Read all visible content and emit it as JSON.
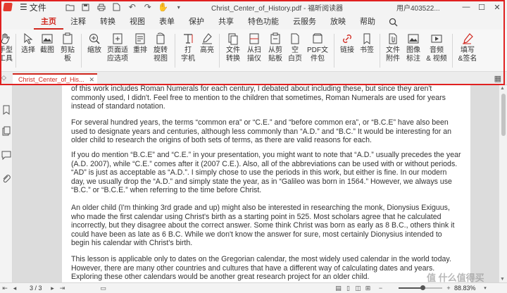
{
  "titlebar": {
    "menu_label": "文件",
    "doc_title": "Christ_Center_of_History.pdf - 福昕阅读器",
    "user": "用户403522..."
  },
  "tabs": [
    "主页",
    "注释",
    "转换",
    "视图",
    "表单",
    "保护",
    "共享",
    "特色功能",
    "云服务",
    "放映",
    "帮助"
  ],
  "active_tab": "主页",
  "ribbon": {
    "hand": "手型\n工具",
    "select": "选择",
    "snapshot": "截图",
    "clipboard": "剪贴\n板",
    "zoom": "缩放",
    "fit_page": "页面适\n应选项",
    "reflow": "重排",
    "rotate": "旋转\n视图",
    "typewriter": "打\n字机",
    "highlight": "高亮",
    "convert": "文件\n转换",
    "from_scanner": "从扫\n描仪",
    "from_clipboard": "从剪\n贴板",
    "blank": "空\n白页",
    "pdf_pack": "PDF文\n件包",
    "link": "链接",
    "bookmark": "书签",
    "attach": "文件\n附件",
    "image_note": "图像\n标注",
    "audio_video": "音频\n& 视频",
    "fill_sign": "填写\n&签名"
  },
  "doc_tab": {
    "label": "Christ_Center_of_His..."
  },
  "document": {
    "paragraphs": [
      "of this work includes Roman Numerals for each century, I debated about including these, but since they aren't commonly used, I didn't. Feel free to mention to the children that sometimes, Roman Numerals are used for years instead of standard notation.",
      "For several hundred years, the terms “common era” or “C.E.” and “before common era”, or “B.C.E” have also been used to designate years and centuries, although less commonly than “A.D.” and “B.C.” It would be interesting for an older child to research the origins of both sets of terms, as there are valid reasons for each.",
      "If you do mention “B.C.E” and “C.E.” in your presentation, you might want to note that “A.D.” usually precedes the year (A.D. 2007), while “C.E.” comes after it (2007 C.E.). Also, all of the abbreviations can be used with or without periods. “AD” is just as acceptable as “A.D.”. I simply chose to use the periods in this work, but either is fine. In our modern day, we usually drop the “A.D.” and simply state the year, as in “Galileo was born in 1564.” However, we always use “B.C.” or “B.C.E.” when referring to the time before Christ.",
      "An older child (I'm thinking 3rd grade and up) might also be interested in researching the monk, Dionysius Exiguus, who made the first calendar using Christ's birth as a starting point in 525. Most scholars agree that he calculated incorrectly, but they disagree about the correct answer. Some think Christ was born as early as 8 B.C., others think it could have been as late as 6 B.C. While we don't know the answer for sure, most certainly Dionysius intended to begin his calendar with Christ's birth.",
      "This lesson is applicable only to dates on the Gregorian calendar, the most widely used calendar in the world today. However, there are many other countries and cultures that have a different way of calculating dates and years. Exploring these other calendars would be another great research project for an older child."
    ]
  },
  "status": {
    "page_indicator": "3 / 3",
    "zoom": "88.83%",
    "zoom_fraction": 0.55
  },
  "watermark": "值 什么值得买",
  "colors": {
    "accent": "#d0261d",
    "annotation": "#e02020"
  }
}
